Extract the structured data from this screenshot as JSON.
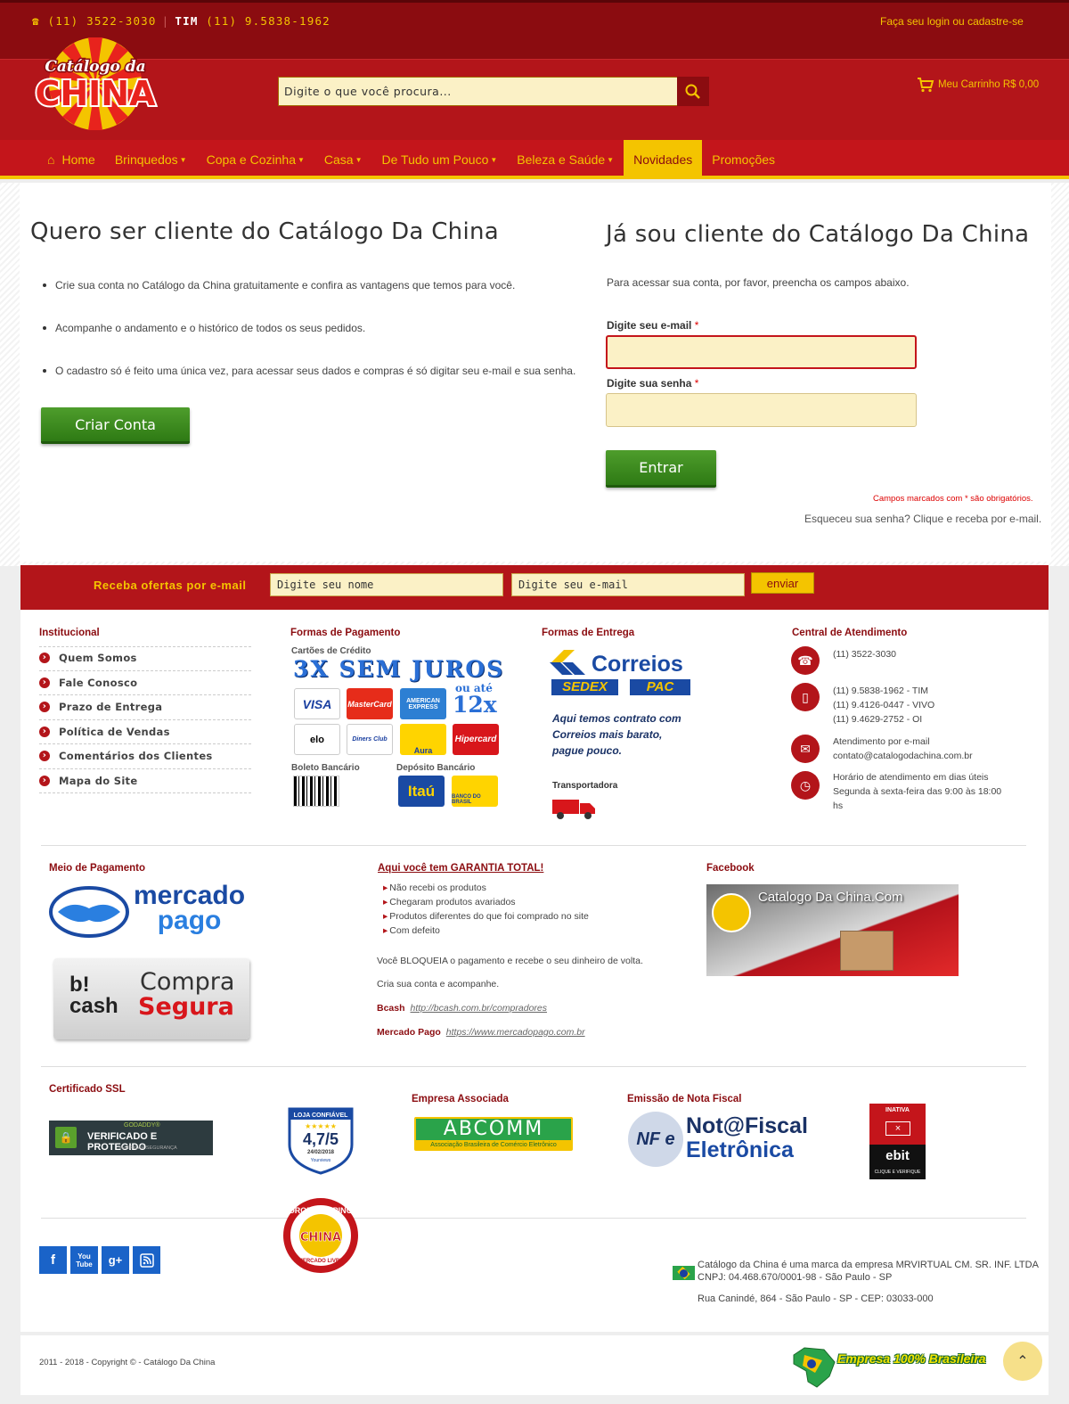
{
  "topbar": {
    "phone_main": "(11) 3522-3030",
    "carrier": "TIM",
    "phone_tim": "(11) 9.5838-1962",
    "login_link": "Faça seu login ou cadastre-se"
  },
  "logo": {
    "line1": "Catálogo da",
    "line2": "CHINA"
  },
  "search": {
    "placeholder": "Digite o que você procura..."
  },
  "cart": {
    "label": "Meu Carrinho R$ 0,00"
  },
  "nav": {
    "items": [
      {
        "label": "Home"
      },
      {
        "label": "Brinquedos"
      },
      {
        "label": "Copa e Cozinha"
      },
      {
        "label": "Casa"
      },
      {
        "label": "De Tudo um Pouco"
      },
      {
        "label": "Beleza e Saúde"
      },
      {
        "label": "Novidades"
      },
      {
        "label": "Promoções"
      }
    ]
  },
  "register": {
    "title": "Quero ser cliente do Catálogo Da China",
    "bullets": [
      "Crie sua conta no Catálogo da China gratuitamente e confira as vantagens que temos para você.",
      "Acompanhe o andamento e o histórico de todos os seus pedidos.",
      "O cadastro só é feito uma única vez, para acessar seus dados e compras é só digitar seu e-mail e sua senha."
    ],
    "button": "Criar Conta"
  },
  "login": {
    "title": "Já sou cliente do Catálogo Da China",
    "intro": "Para acessar sua conta, por favor, preencha os campos abaixo.",
    "email_label": "Digite seu e-mail",
    "password_label": "Digite sua senha",
    "required_mark": "*",
    "button": "Entrar",
    "required_note": "Campos marcados com * são obrigatórios.",
    "forgot": "Esqueceu sua senha? Clique e receba por e-mail."
  },
  "newsletter": {
    "title": "Receba ofertas por e-mail",
    "name_placeholder": "Digite seu nome",
    "email_placeholder": "Digite seu e-mail",
    "button": "enviar"
  },
  "footer": {
    "institucional": {
      "title": "Institucional",
      "links": [
        "Quem Somos",
        "Fale Conosco",
        "Prazo de Entrega",
        "Política de Vendas",
        "Comentários dos Clientes",
        "Mapa do Site"
      ]
    },
    "pagamento": {
      "title": "Formas de Pagamento",
      "cards_label": "Cartões de Crédito",
      "promo": "3X SEM JUROS",
      "promo_alt": "ou até",
      "promo_max": "12x",
      "cards": [
        "VISA",
        "MasterCard",
        "AMERICAN EXPRESS",
        "elo",
        "Diners Club",
        "Aura",
        "Hipercard"
      ],
      "boleto_label": "Boleto Bancário",
      "deposito_label": "Depósito Bancário",
      "banks": [
        "Itaú",
        "BANCO DO BRASIL"
      ]
    },
    "entrega": {
      "title": "Formas de Entrega",
      "correios": "Correios",
      "sedex": "SEDEX",
      "pac": "PAC",
      "note": "Aqui temos contrato com Correios mais barato, pague pouco.",
      "transportadora": "Transportadora"
    },
    "atendimento": {
      "title": "Central de Atendimento",
      "phone": "(11) 3522-3030",
      "mobiles": [
        "(11) 9.5838-1962 - TIM",
        "(11) 9.4126-0447 - VIVO",
        "(11) 9.4629-2752 - OI"
      ],
      "email_label": "Atendimento por e-mail",
      "email": "contato@catalogodachina.com.br",
      "hours_label": "Horário de atendimento em dias úteis",
      "hours": "Segunda à sexta-feira das 9:00 às 18:00 hs"
    },
    "meio_pagamento": {
      "title": "Meio de Pagamento",
      "mp_line1": "mercado",
      "mp_line2": "pago",
      "bcash_logo": "b! cash",
      "bcash_line1": "Compra",
      "bcash_line2": "Segura"
    },
    "garantia": {
      "title": "Aqui você tem GARANTIA TOTAL!",
      "items": [
        "Não recebi os produtos",
        "Chegaram produtos avariados",
        "Produtos diferentes do que foi comprado no site",
        "Com defeito"
      ],
      "bloqueia": "Você BLOQUEIA o pagamento e recebe o seu dinheiro de volta.",
      "cria": "Cria sua conta e acompanhe.",
      "bcash_label": "Bcash",
      "bcash_url": "http://bcash.com.br/compradores",
      "mp_label": "Mercado Pago",
      "mp_url": "https://www.mercadopago.com.br"
    },
    "facebook": {
      "title": "Facebook",
      "page_name": "Catalogo Da China.Com"
    },
    "ssl": {
      "title": "Certificado SSL",
      "brand": "GODADDY®",
      "badge": "VERIFICADO E PROTEGIDO",
      "sub": "VERIFICAR SEGURANÇA"
    },
    "loja": {
      "top": "LOJA CONFIÁVEL",
      "rating": "4,7/5",
      "date": "24/02/2018",
      "brand": "Yourviews"
    },
    "associada": {
      "title": "Empresa Associada",
      "logo": "ABCOMM",
      "sub": "Associação Brasileira de Comércio Eletrônico"
    },
    "nota": {
      "title": "Emissão de Nota Fiscal",
      "line1": "Not@Fiscal",
      "line2": "Eletrônica",
      "nfe": "NF e"
    },
    "ebit": {
      "status": "INATIVA",
      "brand": "ebit",
      "cta": "CLIQUE E VERIFIQUE"
    },
    "dropship": {
      "top": "DROP SHIPPING",
      "bottom": "MERCADO LIVRE"
    },
    "company": {
      "line1": "Catálogo da China é uma marca da empresa MRVIRTUAL CM. SR. INF. LTDA",
      "line2": "CNPJ: 04.468.670/0001-98 - São Paulo - SP",
      "address": "Rua Canindé, 864 - São Paulo - SP - CEP: 03033-000"
    },
    "copyright": "2011 - 2018 - Copyright © - Catálogo Da China",
    "brasileira": "Empresa 100% Brasileira"
  },
  "colors": {
    "brand_red": "#b3151a",
    "dark_red": "#8b0c10",
    "accent_yellow": "#f4c400",
    "button_green": "#3d8c1f"
  },
  "icons": [
    "phone-icon",
    "search-icon",
    "cart-icon",
    "home-icon",
    "facebook-icon",
    "youtube-icon",
    "googleplus-icon",
    "rss-icon",
    "chevron-up-icon"
  ]
}
